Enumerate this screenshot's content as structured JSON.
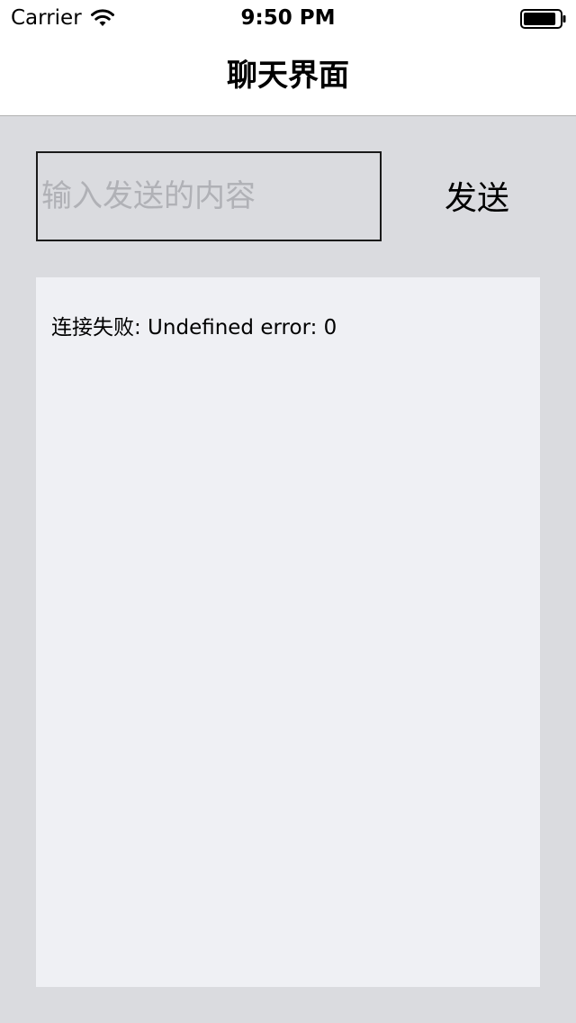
{
  "status_bar": {
    "carrier": "Carrier",
    "time": "9:50 PM",
    "wifi_icon": "wifi-icon",
    "battery_icon": "battery-icon",
    "battery_level": 0.9
  },
  "nav": {
    "title": "聊天界面"
  },
  "composer": {
    "input_value": "",
    "input_placeholder": "输入发送的内容",
    "send_label": "发送"
  },
  "log": {
    "message": "连接失败: Undefined error: 0"
  },
  "colors": {
    "background": "#dadbdf",
    "panel": "#eff0f4",
    "bar": "#ffffff",
    "placeholder": "#b0b1b6",
    "border": "#1a1a1a"
  }
}
